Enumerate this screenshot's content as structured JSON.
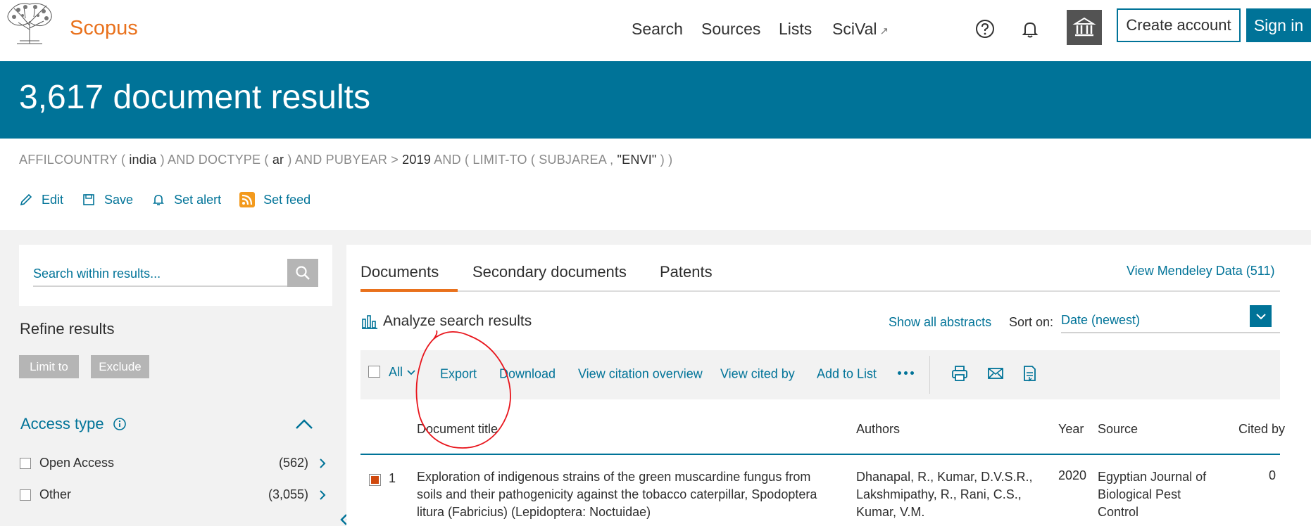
{
  "header": {
    "logo_text": "Scopus",
    "nav": [
      "Search",
      "Sources",
      "Lists",
      "SciVal"
    ],
    "create_account": "Create account",
    "sign_in": "Sign in"
  },
  "banner": {
    "title": "3,617 document results"
  },
  "query": {
    "parts": [
      "AFFILCOUNTRY ( ",
      "india",
      " ) AND DOCTYPE ( ",
      "ar",
      " ) AND PUBYEAR > ",
      "2019",
      " AND ( LIMIT-TO ( SUBJAREA , ",
      "\"ENVI\"",
      " ) )"
    ]
  },
  "query_actions": [
    "Edit",
    "Save",
    "Set alert",
    "Set feed"
  ],
  "left": {
    "search_placeholder": "Search within results...",
    "refine_title": "Refine results",
    "limit_to": "Limit to",
    "exclude": "Exclude",
    "access_type_title": "Access type",
    "facets": [
      {
        "label": "Open Access",
        "count": "(562)"
      },
      {
        "label": "Other",
        "count": "(3,055)"
      }
    ]
  },
  "results": {
    "tabs": [
      "Documents",
      "Secondary documents",
      "Patents"
    ],
    "mendeley": "View Mendeley Data (511)",
    "analyze": "Analyze search results",
    "show_abstracts": "Show all abstracts",
    "sort_label": "Sort on:",
    "sort_value": "Date (newest)",
    "toolbar": {
      "all": "All",
      "export": "Export",
      "download": "Download",
      "citation_overview": "View citation overview",
      "cited_by": "View cited by",
      "add_to_list": "Add to List"
    },
    "columns": {
      "title": "Document title",
      "authors": "Authors",
      "year": "Year",
      "source": "Source",
      "cited_by": "Cited by"
    },
    "rows": [
      {
        "num": "1",
        "title": "Exploration of indigenous strains of the green muscardine fungus from soils and their pathogenicity against the tobacco caterpillar, Spodoptera litura (Fabricius) (Lepidoptera: Noctuidae)",
        "authors": "Dhanapal, R., Kumar, D.V.S.R., Lakshmipathy, R., Rani, C.S., Kumar, V.M.",
        "year": "2020",
        "source": "Egyptian Journal of Biological Pest Control",
        "cited_by": "0"
      }
    ]
  },
  "colors": {
    "brand_orange": "#e9711c",
    "primary_blue": "#007398",
    "annotation_red": "#e8141b"
  }
}
